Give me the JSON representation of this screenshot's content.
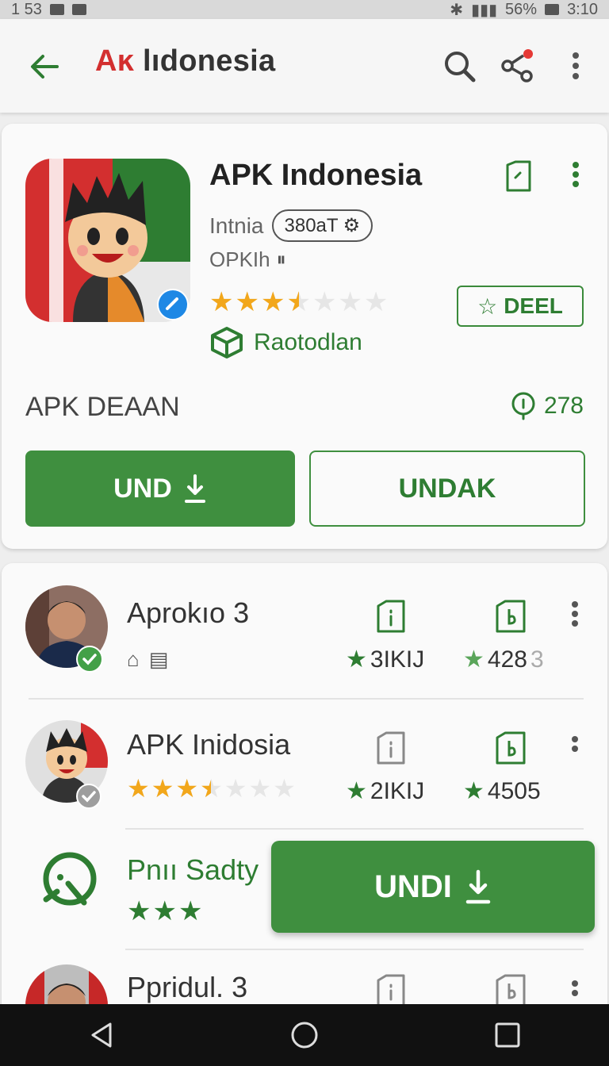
{
  "status_bar": {
    "time_left": "1 53",
    "battery": "56%",
    "time_right": "3:10"
  },
  "app_bar": {
    "title_prefix": "Aĸ",
    "title_rest": " lıdonesia",
    "back_icon": "arrow-left-icon",
    "search_icon": "search-icon",
    "share_icon": "share-icon",
    "menu_icon": "more-vert-icon"
  },
  "app": {
    "title": "APK Indonesia",
    "developer": "Intnia",
    "pill": "380aT",
    "version": "OPKIh",
    "rating": 3.5,
    "deel_label": "DEEL",
    "category": "Raotodlan",
    "section": "APK DEAAN",
    "count": "278",
    "primary_button": "UND",
    "secondary_button": "UNDAK"
  },
  "list": [
    {
      "name": "Aprokıo 3",
      "stat1": "3IKIJ",
      "stat2": "428",
      "stat2_suffix": "3"
    },
    {
      "name": "APK Inidosia",
      "rating": 3.5,
      "stat1": "2IKIJ",
      "stat2": "4505"
    },
    {
      "name": "Pnıı Sadty",
      "rating": 3
    },
    {
      "name": "Ppridul. 3"
    }
  ],
  "floating_button": "UNDI",
  "colors": {
    "accent": "#3f8f3f",
    "title_red": "#d32f2f",
    "star": "#f2a71b",
    "star_green": "#2e7d32"
  }
}
